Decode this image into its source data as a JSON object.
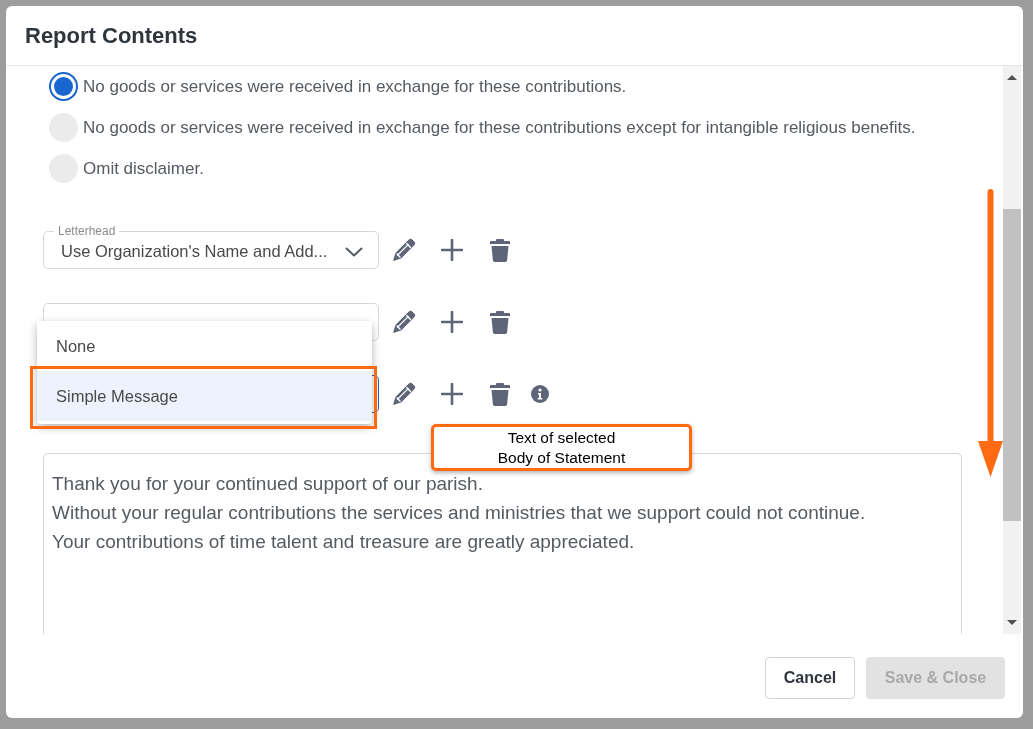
{
  "dialog": {
    "title": "Report Contents"
  },
  "disclaimer_options": [
    {
      "label": "No goods or services were received in exchange for these contributions.",
      "selected": true
    },
    {
      "label": "No goods or services were received in exchange for these contributions except for intangible religious benefits.",
      "selected": false
    },
    {
      "label": "Omit disclaimer.",
      "selected": false
    }
  ],
  "selects": [
    {
      "label": "Letterhead",
      "value": "Use Organization's Name and Add...",
      "focused": false,
      "info_icon": false
    },
    {
      "focused": false,
      "info_icon": false
    },
    {
      "focused": true,
      "info_icon": true
    }
  ],
  "dropdown": {
    "options": [
      {
        "label": "None",
        "selected": false,
        "highlighted": false
      },
      {
        "label": "Simple Message",
        "selected": true,
        "highlighted": true
      }
    ]
  },
  "body_text": {
    "lines": [
      "Thank you for your continued support of our parish.",
      "Without your regular contributions the services and ministries that we support could not continue.",
      "Your contributions of time talent and treasure are greatly appreciated."
    ]
  },
  "callout": {
    "lines": [
      "Text of selected",
      "Body of Statement"
    ]
  },
  "buttons": [
    {
      "label": "Cancel",
      "disabled": false
    },
    {
      "label": "Save & Close",
      "disabled": true
    }
  ]
}
